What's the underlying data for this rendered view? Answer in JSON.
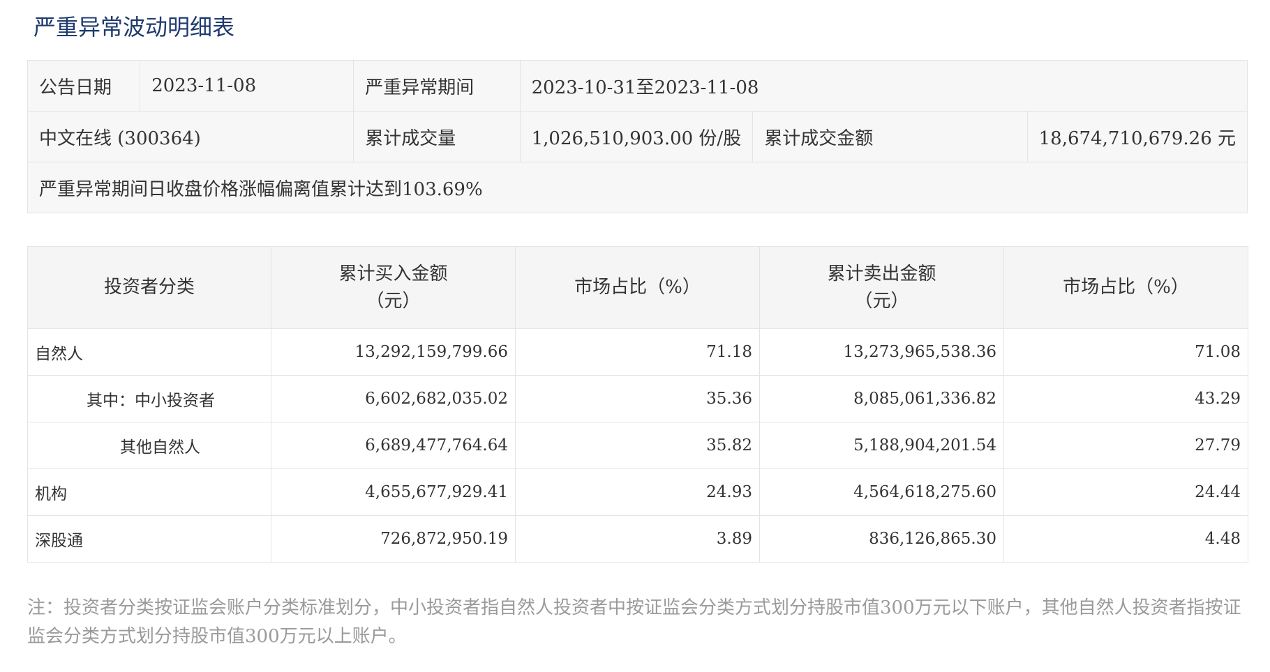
{
  "title": "严重异常波动明细表",
  "summary": {
    "announce_date_label": "公告日期",
    "announce_date": "2023-11-08",
    "period_label": "严重异常期间",
    "period": "2023-10-31至2023-11-08",
    "stock": "中文在线 (300364)",
    "volume_label": "累计成交量",
    "volume": "1,026,510,903.00 份/股",
    "amount_label": "累计成交金额",
    "amount": "18,674,710,679.26 元",
    "description": "严重异常期间日收盘价格涨幅偏离值累计达到103.69%"
  },
  "table": {
    "headers": [
      {
        "line1": "投资者分类",
        "line2": ""
      },
      {
        "line1": "累计买入金额",
        "line2": "（元）"
      },
      {
        "line1": "市场占比（%）",
        "line2": ""
      },
      {
        "line1": "累计卖出金额",
        "line2": "（元）"
      },
      {
        "line1": "市场占比（%）",
        "line2": ""
      }
    ],
    "rows": [
      {
        "category": "自然人",
        "buy": "13,292,159,799.66",
        "buy_pct": "71.18",
        "sell": "13,273,965,538.36",
        "sell_pct": "71.08"
      },
      {
        "category": "其中：中小投资者",
        "buy": "6,602,682,035.02",
        "buy_pct": "35.36",
        "sell": "8,085,061,336.82",
        "sell_pct": "43.29"
      },
      {
        "category": "其他自然人",
        "buy": "6,689,477,764.64",
        "buy_pct": "35.82",
        "sell": "5,188,904,201.54",
        "sell_pct": "27.79"
      },
      {
        "category": "机构",
        "buy": "4,655,677,929.41",
        "buy_pct": "24.93",
        "sell": "4,564,618,275.60",
        "sell_pct": "24.44"
      },
      {
        "category": "深股通",
        "buy": "726,872,950.19",
        "buy_pct": "3.89",
        "sell": "836,126,865.30",
        "sell_pct": "4.48"
      }
    ]
  },
  "note": "注：投资者分类按证监会账户分类标准划分，中小投资者指自然人投资者中按证监会分类方式划分持股市值300万元以下账户，其他自然人投资者指按证监会分类方式划分持股市值300万元以上账户。"
}
